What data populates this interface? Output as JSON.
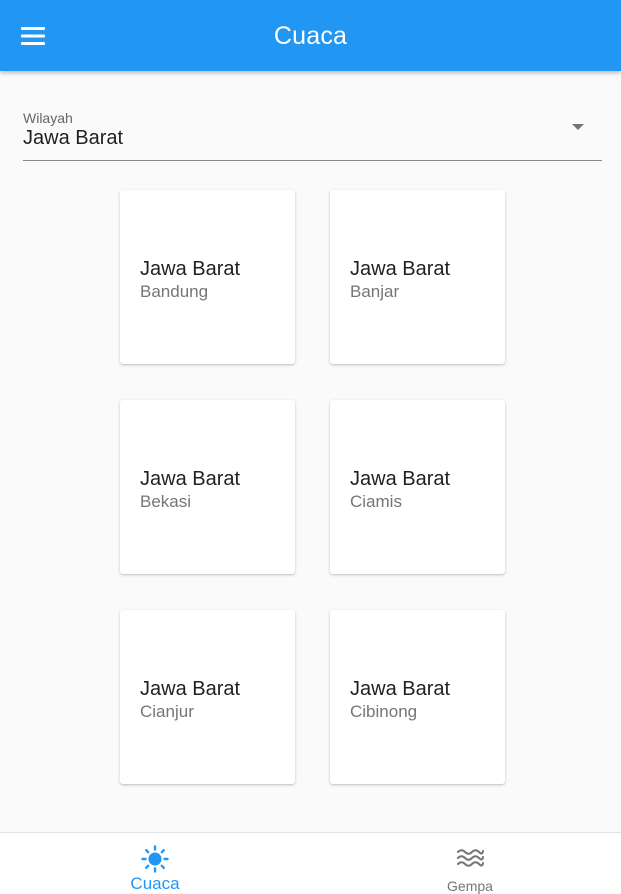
{
  "appbar": {
    "title": "Cuaca",
    "menu_icon": "menu-icon",
    "color": "#2196f3"
  },
  "region_field": {
    "label": "Wilayah",
    "value": "Jawa Barat"
  },
  "cards": [
    {
      "province": "Jawa Barat",
      "city": "Bandung"
    },
    {
      "province": "Jawa Barat",
      "city": "Banjar"
    },
    {
      "province": "Jawa Barat",
      "city": "Bekasi"
    },
    {
      "province": "Jawa Barat",
      "city": "Ciamis"
    },
    {
      "province": "Jawa Barat",
      "city": "Cianjur"
    },
    {
      "province": "Jawa Barat",
      "city": "Cibinong"
    }
  ],
  "bottom_nav": {
    "items": [
      {
        "label": "Cuaca",
        "icon": "sun-icon",
        "active": true
      },
      {
        "label": "Gempa",
        "icon": "waves-icon",
        "active": false
      }
    ],
    "active_color": "#2196f3",
    "inactive_color": "#757575"
  }
}
